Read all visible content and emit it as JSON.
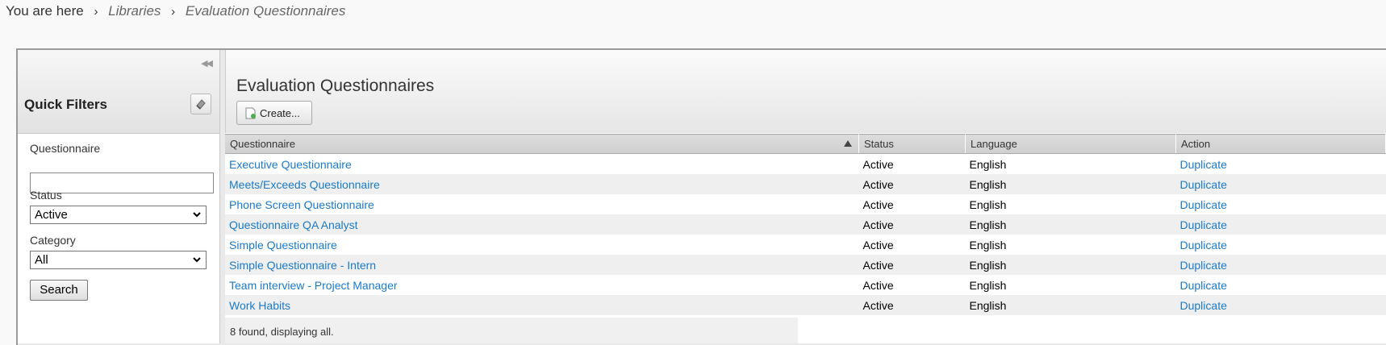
{
  "breadcrumb": {
    "prefix": "You are here",
    "items": [
      "Libraries",
      "Evaluation Questionnaires"
    ]
  },
  "quick_filters": {
    "title": "Quick Filters",
    "questionnaire_label": "Questionnaire",
    "questionnaire_value": "",
    "status_label": "Status",
    "status_value": "Active",
    "category_label": "Category",
    "category_value": "All",
    "search_label": "Search"
  },
  "main": {
    "title": "Evaluation Questionnaires",
    "create_label": "Create...",
    "columns": [
      "Questionnaire",
      "Status",
      "Language",
      "Action"
    ],
    "rows": [
      {
        "name": "Executive Questionnaire",
        "status": "Active",
        "language": "English",
        "action": "Duplicate"
      },
      {
        "name": "Meets/Exceeds Questionnaire",
        "status": "Active",
        "language": "English",
        "action": "Duplicate"
      },
      {
        "name": "Phone Screen Questionnaire",
        "status": "Active",
        "language": "English",
        "action": "Duplicate"
      },
      {
        "name": "Questionnaire QA Analyst",
        "status": "Active",
        "language": "English",
        "action": "Duplicate"
      },
      {
        "name": "Simple Questionnaire",
        "status": "Active",
        "language": "English",
        "action": "Duplicate"
      },
      {
        "name": "Simple Questionnaire - Intern",
        "status": "Active",
        "language": "English",
        "action": "Duplicate"
      },
      {
        "name": "Team interview - Project Manager",
        "status": "Active",
        "language": "English",
        "action": "Duplicate"
      },
      {
        "name": "Work Habits",
        "status": "Active",
        "language": "English",
        "action": "Duplicate"
      }
    ],
    "footer": "8 found, displaying all."
  },
  "colors": {
    "link": "#1a7ac9",
    "header_bg": "#d5d5d5",
    "row_alt": "#efefef"
  }
}
